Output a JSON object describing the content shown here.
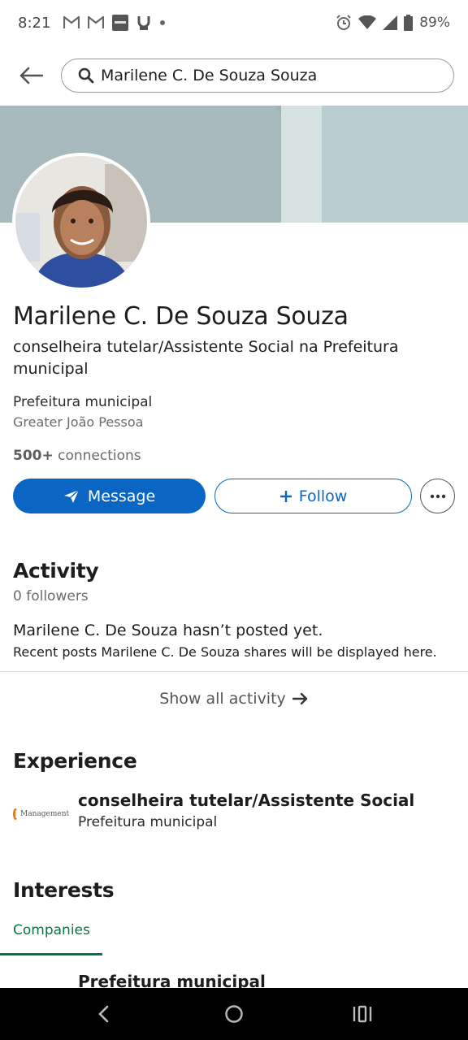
{
  "status_bar": {
    "time": "8:21",
    "notifications": [
      "gmail-icon",
      "gmail-icon",
      "news-app-icon",
      "app-icon",
      "dot-icon"
    ],
    "battery_percent": "89%"
  },
  "search": {
    "query": "Marilene C. De Souza Souza"
  },
  "profile": {
    "name": "Marilene C. De Souza Souza",
    "headline": "conselheira tutelar/Assistente Social na Prefeitura municipal",
    "company": "Prefeitura municipal",
    "location": "Greater João Pessoa",
    "connections_count": "500+",
    "connections_label": "connections"
  },
  "actions": {
    "message_label": "Message",
    "follow_label": "Follow"
  },
  "activity": {
    "title": "Activity",
    "followers": "0 followers",
    "empty_title": "Marilene C. De Souza hasn’t posted yet.",
    "empty_desc": "Recent posts Marilene C. De Souza shares will be displayed here.",
    "show_all": "Show all activity"
  },
  "experience": {
    "title": "Experience",
    "items": [
      {
        "logo_text": "Management",
        "role": "conselheira tutelar/Assistente Social",
        "company": "Prefeitura municipal"
      }
    ]
  },
  "interests": {
    "title": "Interests",
    "tabs": [
      "Companies"
    ],
    "items": [
      "Prefeitura municipal"
    ]
  },
  "colors": {
    "primary": "#0a66c2",
    "interest_tab": "#057642",
    "banner": "#9fb3b6"
  }
}
